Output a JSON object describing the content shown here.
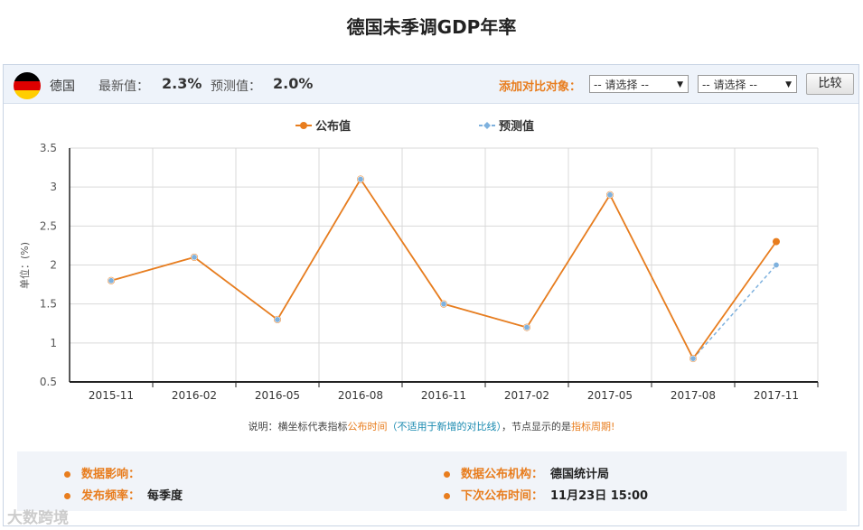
{
  "page": {
    "title": "德国未季调GDP年率"
  },
  "header": {
    "country": "德国",
    "latest_label": "最新值：",
    "latest_value": "2.3%",
    "forecast_label": "预测值：",
    "forecast_value": "2.0%",
    "compare_label": "添加对比对象：",
    "select1": "-- 请选择 --",
    "select2": "-- 请选择 --",
    "compare_button": "比较",
    "flag_colors": [
      "#000000",
      "#dd0000",
      "#ffce00"
    ]
  },
  "chart_data": {
    "type": "line",
    "categories": [
      "2015-11",
      "2016-02",
      "2016-05",
      "2016-08",
      "2016-11",
      "2017-02",
      "2017-05",
      "2017-08",
      "2017-11"
    ],
    "series": [
      {
        "name": "公布值",
        "values": [
          1.8,
          2.1,
          1.3,
          3.1,
          1.5,
          1.2,
          2.9,
          0.8,
          2.3
        ],
        "color": "#e87d1e"
      },
      {
        "name": "预测值",
        "values": [
          1.8,
          2.1,
          1.3,
          3.1,
          1.5,
          1.2,
          2.9,
          0.8,
          2.0
        ],
        "color": "#7eb1de"
      }
    ],
    "ylabel": "单位：(%)",
    "ylim": [
      0.5,
      3.5
    ],
    "yticks": [
      "0.5",
      "1",
      "1.5",
      "2",
      "2.5",
      "3",
      "3.5"
    ],
    "grid": true,
    "legend_position": "top-center"
  },
  "note": {
    "prefix": "说明：横坐标代表指标",
    "orange1": "公布时间",
    "blue": "（不适用于新增的对比线）",
    "middle": "，节点显示的是",
    "orange2": "指标周期!"
  },
  "info": {
    "impact_label": "数据影响：",
    "impact_value": "",
    "freq_label": "发布频率：",
    "freq_value": "每季度",
    "org_label": "数据公布机构：",
    "org_value": "德国统计局",
    "next_label": "下次公布时间：",
    "next_value": "11月23日 15:00"
  },
  "watermark": "大数跨境"
}
